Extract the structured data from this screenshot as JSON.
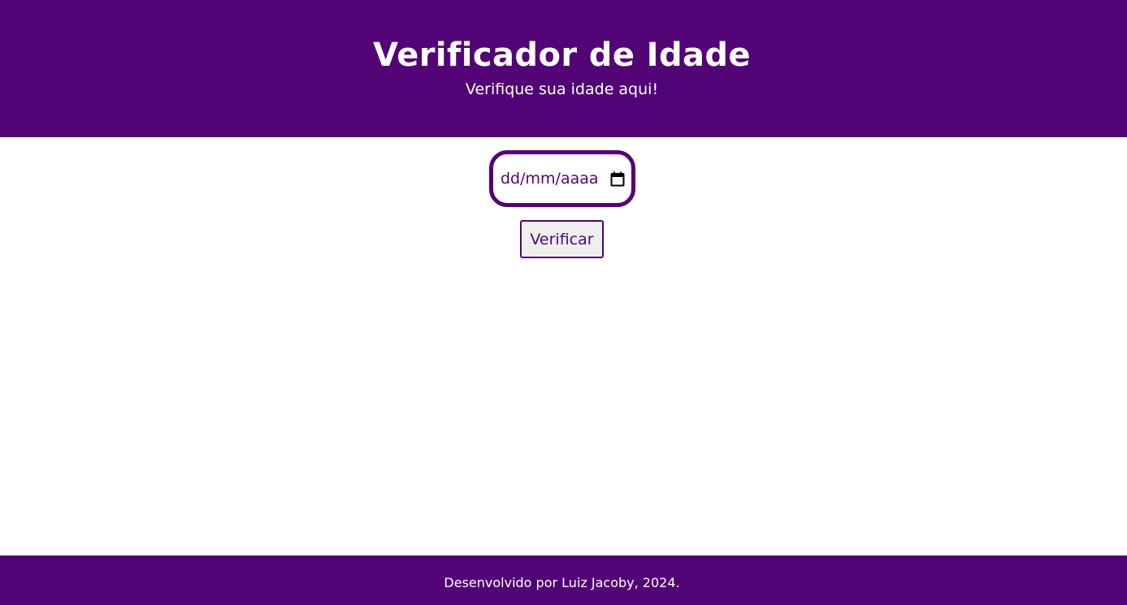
{
  "header": {
    "title": "Verificador de Idade",
    "subtitle": "Verifique sua idade aqui!"
  },
  "form": {
    "date_placeholder": "dd/mm/aaaa",
    "calendar_icon": "calendar-icon",
    "verify_label": "Verificar"
  },
  "footer": {
    "text": "Desenvolvido por Luiz Jacoby, 2024."
  },
  "colors": {
    "brand_purple": "#520375",
    "background": "#ffffff",
    "text_on_brand": "#ffffff",
    "button_background": "#efefef"
  }
}
